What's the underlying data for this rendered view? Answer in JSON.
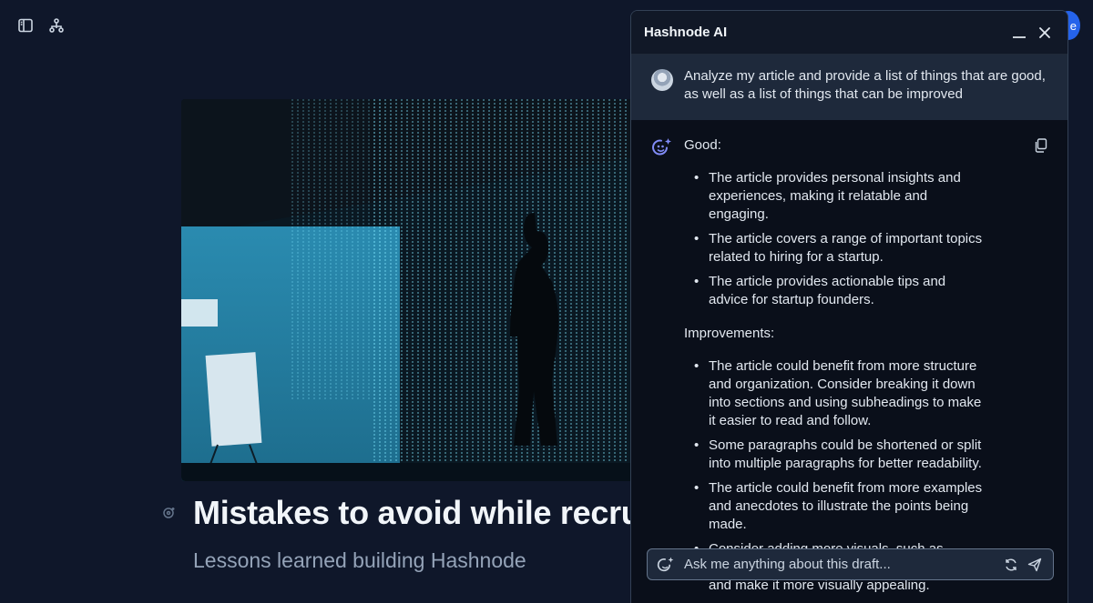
{
  "editor": {
    "title": "Mistakes to avoid while recruiting",
    "subtitle": "Lessons learned building Hashnode",
    "avatar_initial": "e"
  },
  "ai_panel": {
    "title": "Hashnode AI",
    "user_prompt": "Analyze my article and provide a list of things that are good, as well as a list of things that can be improved",
    "response": {
      "good_heading": "Good:",
      "good_items": [
        "The article provides personal insights and experiences, making it relatable and engaging.",
        "The article covers a range of important topics related to hiring for a startup.",
        "The article provides actionable tips and advice for startup founders."
      ],
      "improvements_heading": "Improvements:",
      "improvement_items": [
        "The article could benefit from more structure and organization. Consider breaking it down into sections and using subheadings to make it easier to read and follow.",
        "Some paragraphs could be shortened or split into multiple paragraphs for better readability.",
        "The article could benefit from more examples and anecdotes to illustrate the points being made.",
        "Consider adding more visuals, such as images or infographics, to break up the text and make it more visually appealing."
      ]
    },
    "composer": {
      "placeholder": "Ask me anything about this draft..."
    }
  },
  "colors": {
    "background": "#0f172a",
    "panel": "#0a0f1a",
    "accent": "#818cf8"
  }
}
